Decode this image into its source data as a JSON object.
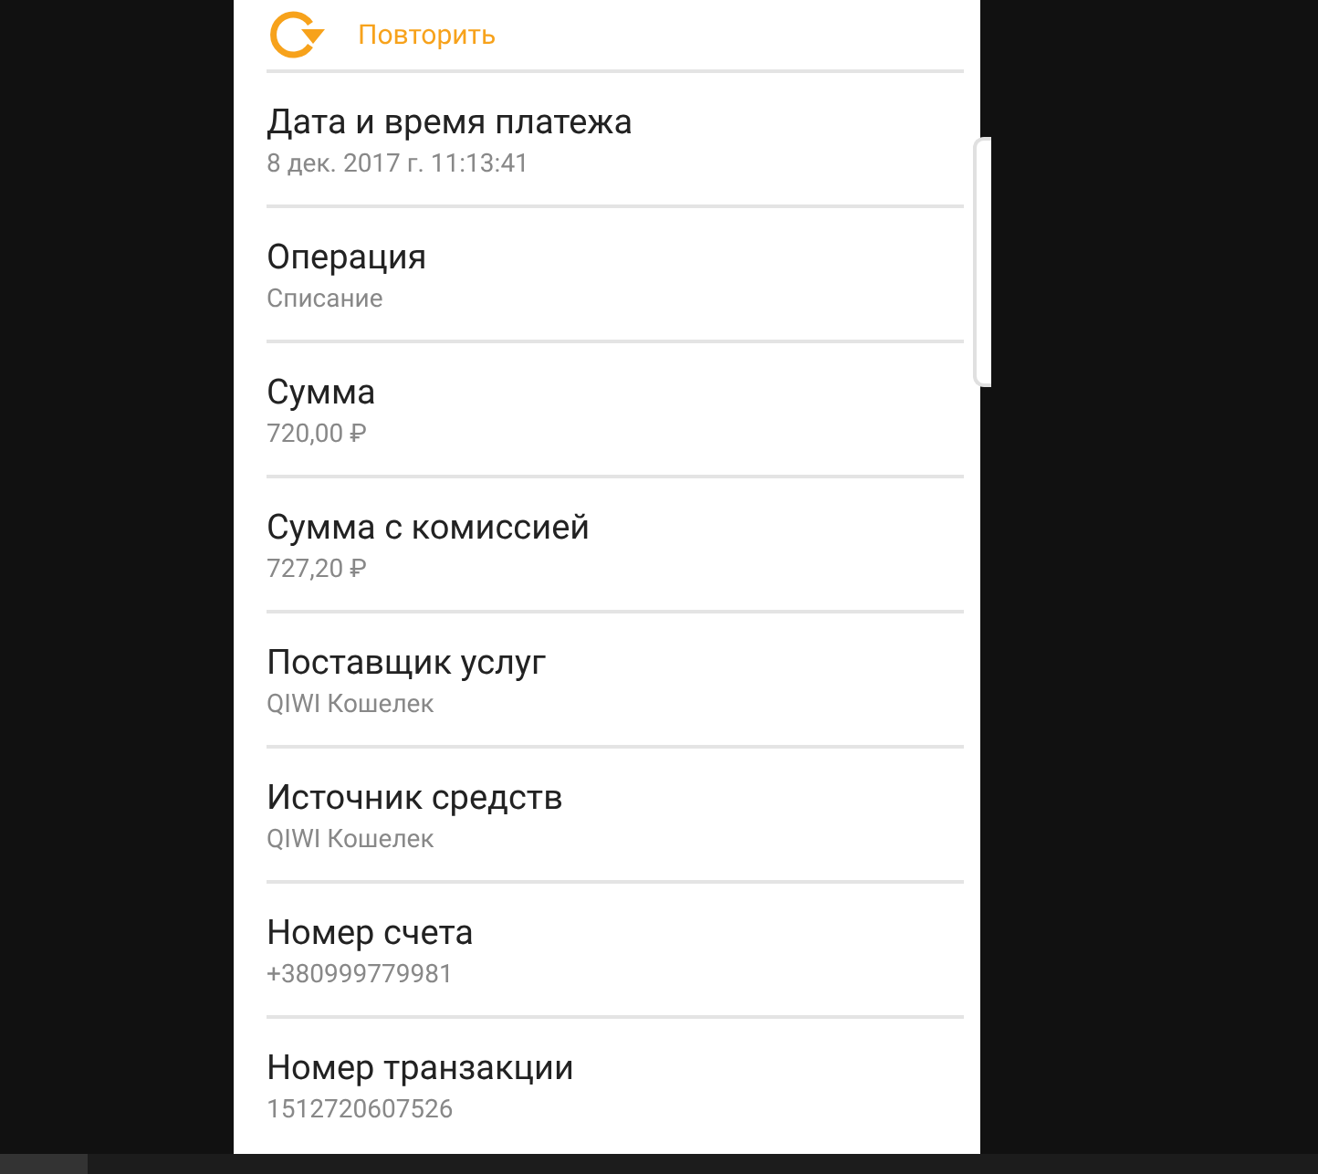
{
  "action": {
    "label": "Повторить"
  },
  "details": [
    {
      "label": "Дата и время платежа",
      "value": "8 дек. 2017 г. 11:13:41"
    },
    {
      "label": "Операция",
      "value": "Списание"
    },
    {
      "label": "Сумма",
      "value": "720,00 ₽"
    },
    {
      "label": "Сумма с комиссией",
      "value": "727,20 ₽"
    },
    {
      "label": "Поставщик услуг",
      "value": "QIWI Кошелек"
    },
    {
      "label": "Источник средств",
      "value": "QIWI Кошелек"
    },
    {
      "label": "Номер счета",
      "value": "+380999779981"
    },
    {
      "label": "Номер транзакции",
      "value": "1512720607526"
    }
  ]
}
